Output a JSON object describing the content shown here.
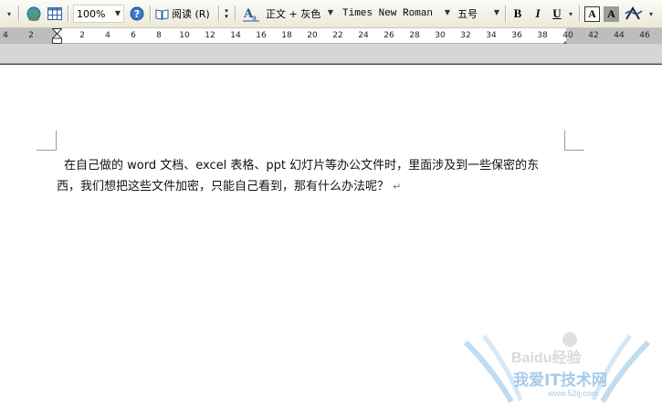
{
  "toolbar": {
    "zoom": "100%",
    "read_label": "阅读 (R)",
    "style_value": "正文 + 灰色",
    "font_value": "Times New Roman",
    "size_value": "五号",
    "bold": "B",
    "italic": "I",
    "underline": "U",
    "char_border": "A",
    "char_shading": "A",
    "icons": [
      "globe-icon",
      "table-icon",
      "help-icon",
      "read-book-icon",
      "style-format-icon",
      "bold-icon",
      "italic-icon",
      "underline-icon",
      "char-border-icon",
      "char-shading-icon",
      "text-effect-icon"
    ]
  },
  "ruler": {
    "ticks": [
      "4",
      "2",
      "2",
      "4",
      "6",
      "8",
      "10",
      "12",
      "14",
      "16",
      "18",
      "20",
      "22",
      "24",
      "26",
      "28",
      "30",
      "32",
      "34",
      "36",
      "38",
      "40",
      "42",
      "44",
      "46"
    ]
  },
  "document": {
    "line1": "在自己做的 word 文档、excel 表格、ppt 幻灯片等办公文件时，里面涉及到一些保密的东",
    "line2": "西，我们想把这些文件加密，只能自己看到，那有什么办法呢？",
    "para_mark": "↵"
  },
  "watermark": {
    "brand": "Baidu经验",
    "site_name": "我爱IT技术网",
    "site_url": "www.52ij.com"
  }
}
